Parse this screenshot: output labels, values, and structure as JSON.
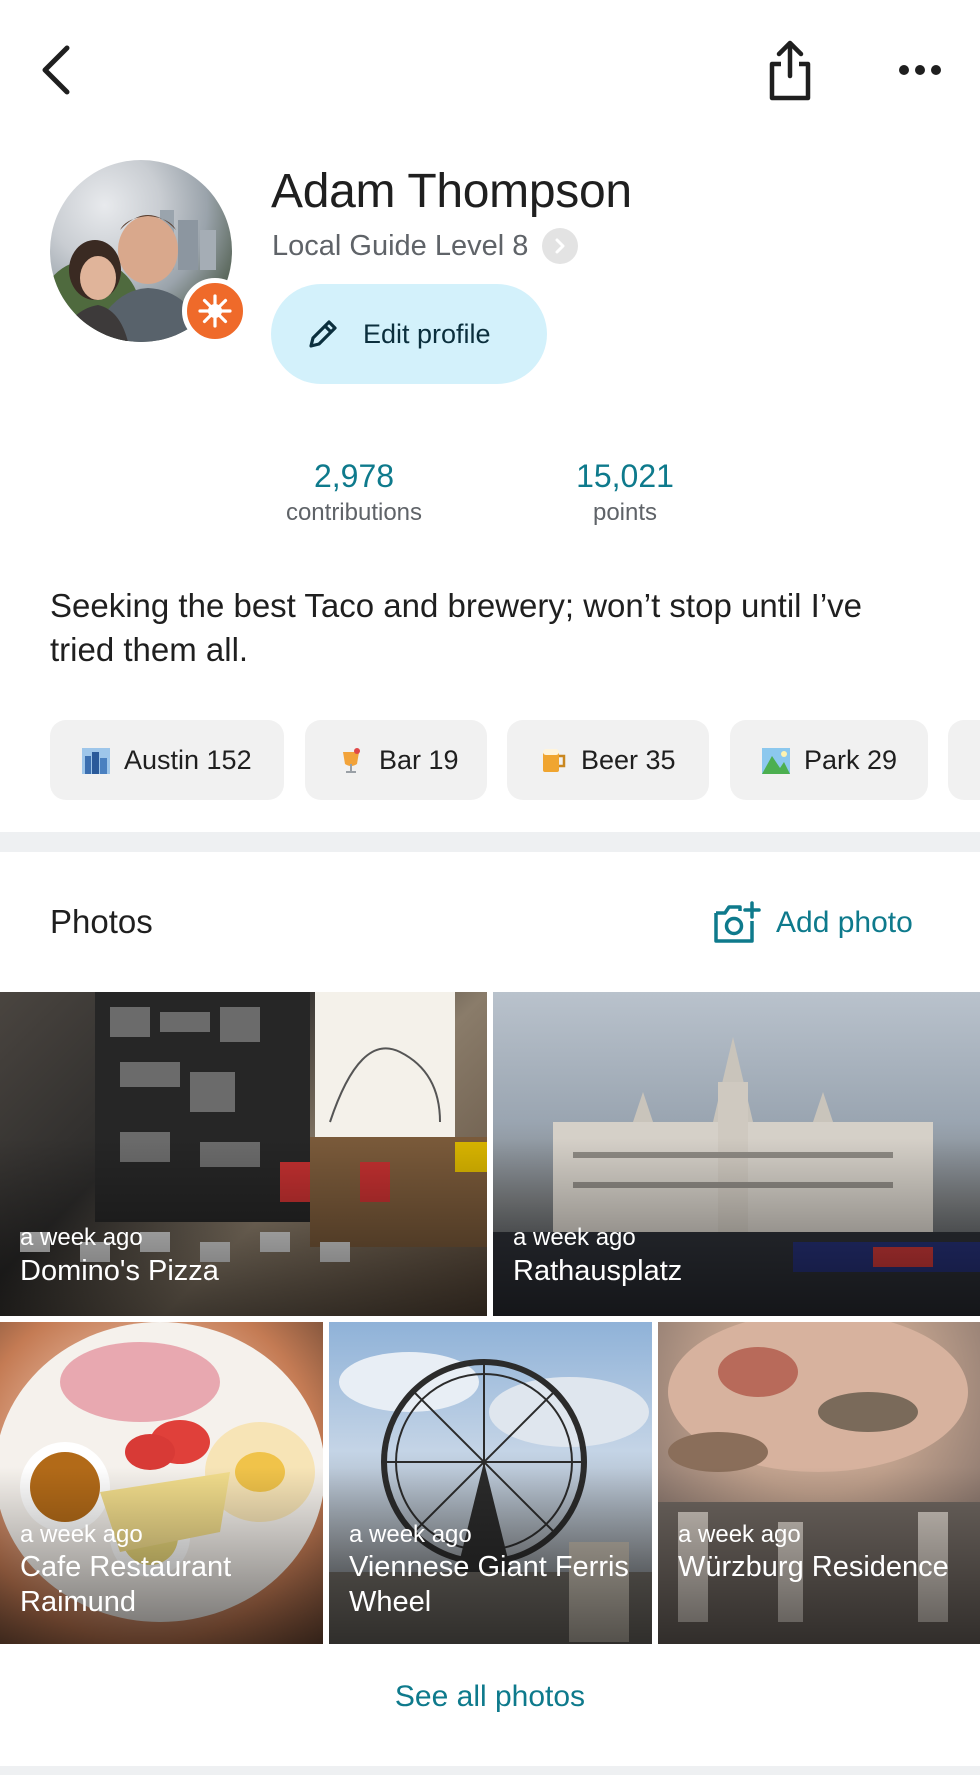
{
  "header": {
    "back_icon": "chevron-left-icon",
    "share_icon": "share-icon",
    "more_icon": "more-horizontal-icon"
  },
  "profile": {
    "name": "Adam Thompson",
    "level": "Local Guide Level 8",
    "edit_label": "Edit profile",
    "badge_color": "#ef6a2a"
  },
  "stats": {
    "contributions_value": "2,978",
    "contributions_label": "contributions",
    "points_value": "15,021",
    "points_label": "points"
  },
  "bio": "Seeking the best Taco and brewery; won’t stop until I’ve tried them all.",
  "chips": [
    {
      "label": "Austin 152",
      "icon": "city-icon"
    },
    {
      "label": "Bar 19",
      "icon": "cocktail-icon"
    },
    {
      "label": "Beer 35",
      "icon": "beer-icon"
    },
    {
      "label": "Park 29",
      "icon": "park-icon"
    }
  ],
  "photos_section": {
    "title": "Photos",
    "add_label": "Add photo",
    "see_all": "See all photos",
    "items": [
      {
        "time": "a week ago",
        "place": "Domino's Pizza"
      },
      {
        "time": "a week ago",
        "place": "Rathausplatz"
      },
      {
        "time": "a week ago",
        "place": "Cafe Restaurant Raimund"
      },
      {
        "time": "a week ago",
        "place": "Viennese Giant Ferris Wheel"
      },
      {
        "time": "a week ago",
        "place": "Würzburg Residence"
      }
    ]
  },
  "colors": {
    "accent": "#0e7a8c",
    "edit_button_bg": "#d3f1fb",
    "chip_bg": "#f1f1f1"
  }
}
